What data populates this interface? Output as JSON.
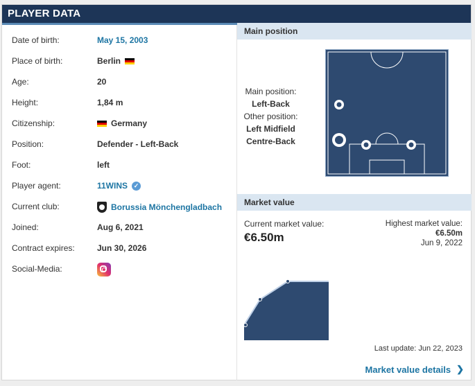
{
  "header": {
    "title": "PLAYER DATA"
  },
  "rows": [
    {
      "label": "Date of birth:",
      "value": "May 15, 2003"
    },
    {
      "label": "Place of birth:",
      "value": "Berlin"
    },
    {
      "label": "Age:",
      "value": "20"
    },
    {
      "label": "Height:",
      "value": "1,84 m"
    },
    {
      "label": "Citizenship:",
      "value": "Germany"
    },
    {
      "label": "Position:",
      "value": "Defender - Left-Back"
    },
    {
      "label": "Foot:",
      "value": "left"
    },
    {
      "label": "Player agent:",
      "value": "11WINS"
    },
    {
      "label": "Current club:",
      "value": "Borussia Mönchengladbach"
    },
    {
      "label": "Joined:",
      "value": "Aug 6, 2021"
    },
    {
      "label": "Contract expires:",
      "value": "Jun 30, 2026"
    },
    {
      "label": "Social-Media:",
      "value": ""
    }
  ],
  "main_position": {
    "heading": "Main position",
    "main_label": "Main position:",
    "main_value": "Left-Back",
    "other_label": "Other position:",
    "other_values": [
      "Left Midfield",
      "Centre-Back"
    ]
  },
  "market_value": {
    "heading": "Market value",
    "current_label": "Current market value:",
    "current_value": "€6.50m",
    "highest_label": "Highest market value:",
    "highest_value": "€6.50m",
    "highest_date": "Jun 9, 2022",
    "last_update": "Last update: Jun 22, 2023",
    "details_link": "Market value details"
  },
  "colors": {
    "header": "#1d3557",
    "accent": "#5a8ab5",
    "link": "#1d75a3",
    "pitch": "#2e4a70"
  }
}
